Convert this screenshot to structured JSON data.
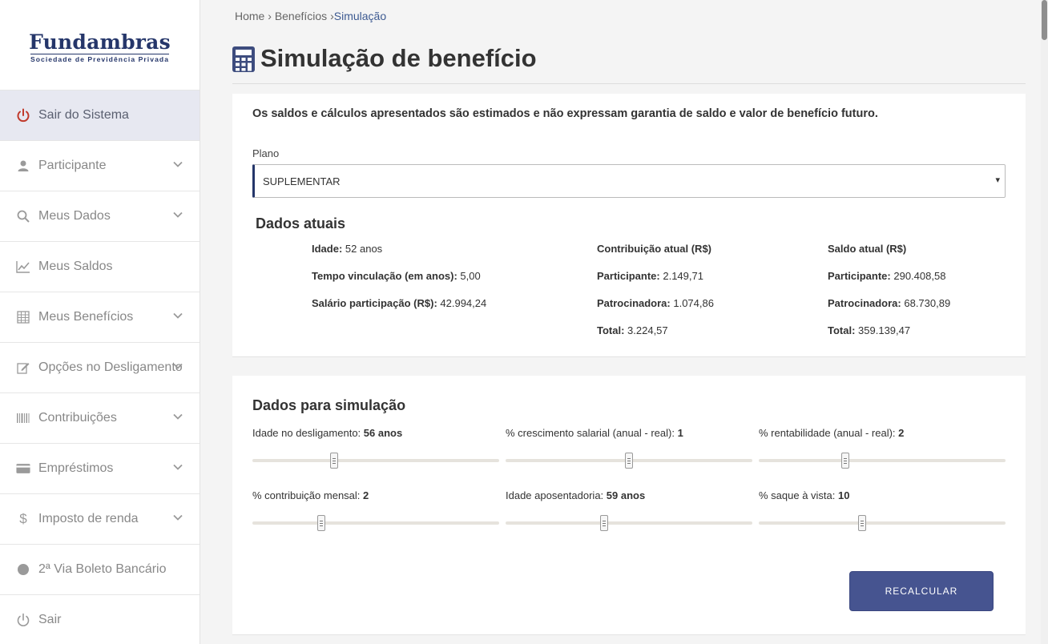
{
  "brand": {
    "name": "Fundambras",
    "subtitle": "Sociedade de Previdência Privada"
  },
  "sidebar": {
    "items": [
      {
        "label": "Sair do Sistema",
        "icon": "power-icon"
      },
      {
        "label": "Participante",
        "icon": "user-icon"
      },
      {
        "label": "Meus Dados",
        "icon": "search-icon"
      },
      {
        "label": "Meus Saldos",
        "icon": "line-chart-icon"
      },
      {
        "label": "Meus Benefícios",
        "icon": "table-icon"
      },
      {
        "label": "Opções no Desligamento",
        "icon": "edit-icon"
      },
      {
        "label": "Contribuições",
        "icon": "barcode-icon"
      },
      {
        "label": "Empréstimos",
        "icon": "credit-card-icon"
      },
      {
        "label": "Imposto de renda",
        "icon": "dollar-icon"
      },
      {
        "label": "2ª Via Boleto Bancário",
        "icon": "circle-icon"
      },
      {
        "label": "Sair",
        "icon": "power-icon"
      }
    ]
  },
  "breadcrumb": {
    "home": "Home",
    "sep1": "›",
    "beneficios": "Benefícios",
    "sep2": "›",
    "current": "Simulação"
  },
  "page": {
    "title": "Simulação de benefício",
    "title_icon": "calculator-icon"
  },
  "notice": "Os saldos e cálculos apresentados são estimados e não expressam garantia de saldo e valor de benefício futuro.",
  "plano": {
    "label": "Plano",
    "value": "SUPLEMENTAR",
    "arrow": "▾"
  },
  "dados_atuais": {
    "title": "Dados atuais",
    "col1": [
      {
        "k": "Idade:",
        "v": " 52 anos"
      },
      {
        "k": "Tempo vinculação (em anos):",
        "v": " 5,00"
      },
      {
        "k": "Salário participação (R$):",
        "v": " 42.994,24"
      }
    ],
    "col2_header": "Contribuição atual (R$)",
    "col2": [
      {
        "k": "Participante:",
        "v": " 2.149,71"
      },
      {
        "k": "Patrocinadora:",
        "v": " 1.074,86"
      },
      {
        "k": "Total:",
        "v": " 3.224,57"
      }
    ],
    "col3_header": "Saldo atual (R$)",
    "col3": [
      {
        "k": "Participante:",
        "v": " 290.408,58"
      },
      {
        "k": "Patrocinadora:",
        "v": " 68.730,89"
      },
      {
        "k": "Total:",
        "v": " 359.139,47"
      }
    ]
  },
  "simulacao": {
    "title": "Dados para simulação",
    "sliders": [
      {
        "label": "Idade no desligamento: ",
        "value": "56 anos",
        "level": 0.33
      },
      {
        "label": "% crescimento salarial (anual - real): ",
        "value": "1",
        "level": 0.5
      },
      {
        "label": "% rentabilidade (anual - real): ",
        "value": "2",
        "level": 0.35
      },
      {
        "label": "% contribuição mensal: ",
        "value": "2",
        "level": 0.28
      },
      {
        "label": "Idade aposentadoria: ",
        "value": "59 anos",
        "level": 0.4
      },
      {
        "label": "% saque à vista: ",
        "value": "10",
        "level": 0.42
      }
    ],
    "button": "RECALCULAR"
  }
}
